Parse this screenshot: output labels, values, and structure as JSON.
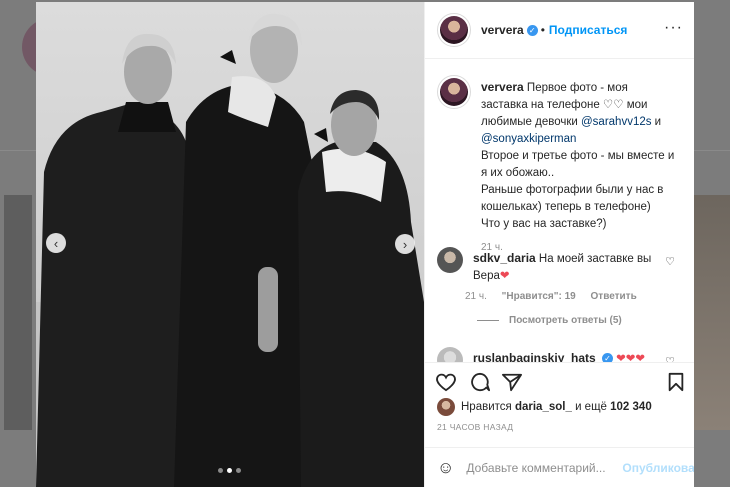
{
  "post": {
    "username": "ververa",
    "follow_label": "Подписаться",
    "more_label": "···",
    "caption_lines": [
      "Первое фото - моя",
      "заставка на телефоне ♡♡ мои",
      "любимые девочки",
      "Второе и третье фото - мы вместе и",
      "я их обожаю..",
      "Раньше фотографии были у нас в",
      "кошельках) теперь в телефоне)",
      "Что у вас на заставке?)"
    ],
    "mention_1": "@sarahvv12s",
    "mention_1_suffix": " и",
    "mention_2": "@sonyaxkiperman",
    "caption_time": "21 ч."
  },
  "comments": [
    {
      "username": "sdkv_daria",
      "text": "На моей заставке вы",
      "text_2": "Вера",
      "emoji": "❤",
      "time": "21 ч.",
      "likes": "\"Нравится\": 19",
      "reply_label": "Ответить"
    },
    {
      "username": "ruslanbaginskiy_hats",
      "emoji": "❤❤❤"
    }
  ],
  "view_replies_label": "Посмотреть ответы (5)",
  "likes": {
    "prefix": "Нравится",
    "user": "daria_sol_",
    "suffix": "и ещё",
    "count": "102 340"
  },
  "timestamp": "21 ЧАСОВ НАЗАД",
  "add_comment": {
    "placeholder": "Добавьте комментарий...",
    "post_label": "Опубликовать"
  },
  "carousel": {
    "prev_arrow": "‹",
    "next_arrow": "›",
    "slides": 3,
    "active_slide": 2
  },
  "colors": {
    "accent": "#0095f6",
    "verified": "#3897f0",
    "heart": "#ed4956"
  }
}
